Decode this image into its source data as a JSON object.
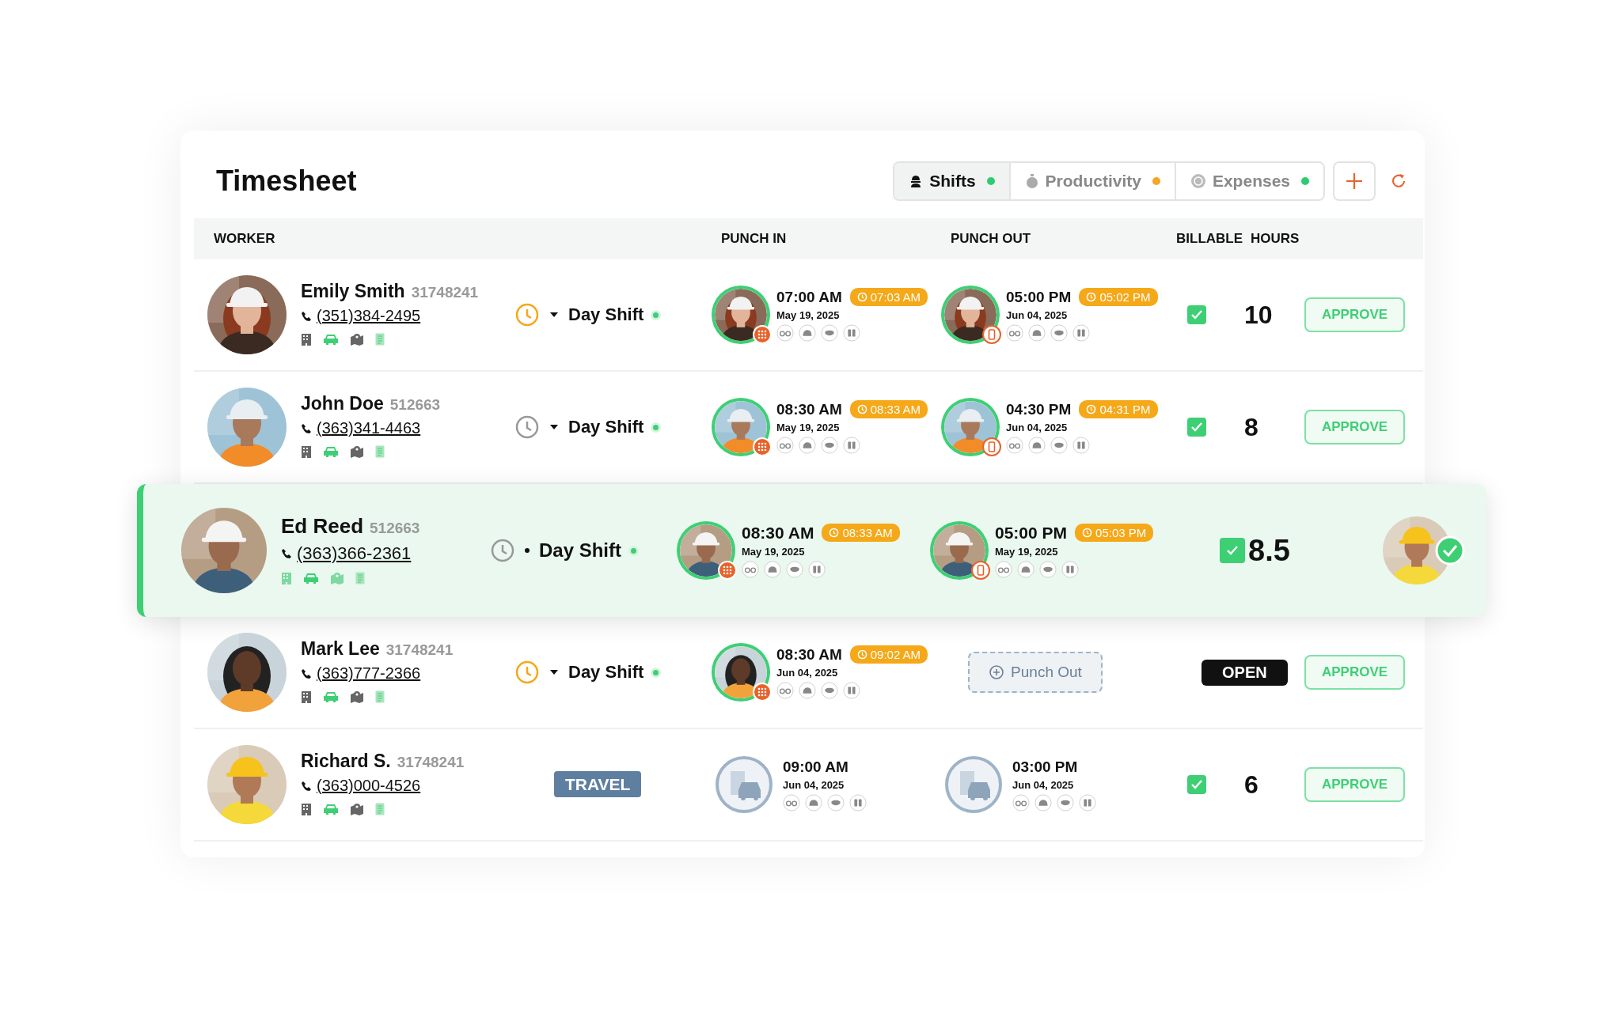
{
  "title": "Timesheet",
  "tabs": [
    {
      "label": "Shifts",
      "selected": true,
      "color": "#2ecc71"
    },
    {
      "label": "Productivity",
      "selected": false,
      "color": "#f5a623"
    },
    {
      "label": "Expenses",
      "selected": false,
      "color": "#2ecc71"
    }
  ],
  "columns": [
    "WORKER",
    "PUNCH IN",
    "PUNCH OUT",
    "BILLABLE",
    "HOURS"
  ],
  "rows": [
    {
      "kind": "shift",
      "highlighted": false,
      "name": "Emily Smith",
      "id": "31748241",
      "phone": "(351)384-2495",
      "timer_on": true,
      "shift": "Day Shift",
      "punch_in": {
        "kind": "keypad",
        "time": "07:00 AM",
        "actual": "07:03 AM",
        "date": "May 19, 2025"
      },
      "punch_out": {
        "kind": "phone",
        "time": "05:00 PM",
        "actual": "05:02 PM",
        "date": "Jun 04, 2025"
      },
      "status": {
        "kind": "billable",
        "checked": true,
        "hours": "10"
      },
      "action": {
        "kind": "button",
        "label": "APPROVE"
      }
    },
    {
      "kind": "shift",
      "highlighted": false,
      "name": "John Doe",
      "id": "512663",
      "phone": "(363)341-4463",
      "timer_on": false,
      "shift": "Day Shift",
      "punch_in": {
        "kind": "keypad",
        "time": "08:30 AM",
        "actual": "08:33 AM",
        "date": "May 19, 2025"
      },
      "punch_out": {
        "kind": "phone",
        "time": "04:30 PM",
        "actual": "04:31 PM",
        "date": "Jun 04, 2025"
      },
      "status": {
        "kind": "billable",
        "checked": true,
        "hours": "8"
      },
      "action": {
        "kind": "button",
        "label": "APPROVE"
      }
    },
    {
      "kind": "shift",
      "highlighted": true,
      "name": "Ed Reed",
      "id": "512663",
      "phone": "(363)366-2361",
      "timer_on": false,
      "shift": "Day Shift",
      "punch_in": {
        "kind": "keypad",
        "time": "08:30 AM",
        "actual": "08:33 AM",
        "date": "May 19, 2025"
      },
      "punch_out": {
        "kind": "phone",
        "time": "05:00 PM",
        "actual": "05:03 PM",
        "date": "May 19, 2025"
      },
      "status": {
        "kind": "billable",
        "checked": true,
        "hours": "8.5"
      }
    },
    {
      "kind": "shift",
      "highlighted": false,
      "name": "Mark Lee",
      "id": "31748241",
      "phone": "(363)777-2366",
      "timer_on": true,
      "shift": "Day Shift",
      "punch_in": {
        "kind": "keypad",
        "time": "08:30 AM",
        "actual": "09:02 AM",
        "date": "Jun 04, 2025"
      },
      "punch_out": {
        "kind": "button",
        "label": "Punch Out"
      },
      "status": {
        "kind": "badge",
        "label": "OPEN"
      },
      "action": {
        "kind": "button",
        "label": "APPROVE"
      }
    },
    {
      "kind": "travel",
      "highlighted": false,
      "name": "Richard S.",
      "id": "31748241",
      "phone": "(363)000-4526",
      "shift": "TRAVEL",
      "punch_in": {
        "kind": "travel",
        "time": "09:00 AM",
        "date": "Jun 04, 2025"
      },
      "punch_out": {
        "kind": "travel",
        "time": "03:00 PM",
        "date": "Jun 04, 2025"
      },
      "status": {
        "kind": "billable",
        "checked": true,
        "hours": "6"
      },
      "action": {
        "kind": "button",
        "label": "APPROVE"
      }
    }
  ]
}
